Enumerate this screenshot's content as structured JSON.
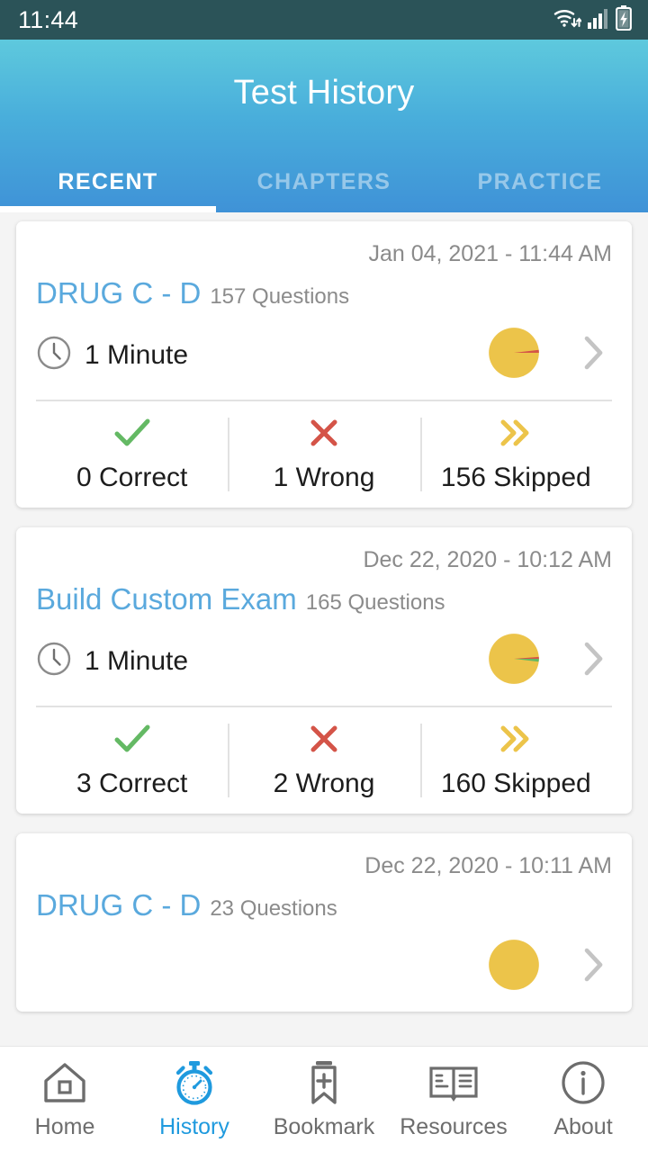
{
  "status_bar": {
    "time": "11:44",
    "icons": [
      "wifi-data-icon",
      "cellular-signal-icon",
      "battery-charging-icon"
    ]
  },
  "header": {
    "title": "Test History",
    "gradient_from": "#5ec9dd",
    "gradient_to": "#3f92d7",
    "tabs": [
      {
        "label": "RECENT",
        "active": true
      },
      {
        "label": "CHAPTERS",
        "active": false
      },
      {
        "label": "PRACTICE",
        "active": false
      }
    ]
  },
  "colors": {
    "accent_blue": "#5aa9dd",
    "active_nav": "#1f9ade",
    "correct_green": "#64b964",
    "wrong_red": "#d45448",
    "skipped_yellow": "#ecc44a",
    "muted_text": "#8b8b8b",
    "status_bar": "#2b5358"
  },
  "list": {
    "cards": [
      {
        "date": "Jan 04, 2021 - 11:44 AM",
        "title": "DRUG C - D",
        "questions": "157 Questions",
        "duration": "1 Minute",
        "chart_data": {
          "type": "pie",
          "title": "DRUG C - D result breakdown",
          "categories": [
            "Correct",
            "Wrong",
            "Skipped"
          ],
          "values": [
            0,
            1,
            156
          ],
          "colors": [
            "#64b964",
            "#d45448",
            "#ecc44a"
          ],
          "legend": "off"
        },
        "stats": [
          {
            "icon": "check-icon",
            "label": "0 Correct",
            "value": 0,
            "kind": "correct"
          },
          {
            "icon": "cross-icon",
            "label": "1 Wrong",
            "value": 1,
            "kind": "wrong"
          },
          {
            "icon": "double-chevron-right-icon",
            "label": "156 Skipped",
            "value": 156,
            "kind": "skipped"
          }
        ]
      },
      {
        "date": "Dec 22, 2020 - 10:12 AM",
        "title": "Build Custom Exam",
        "questions": "165 Questions",
        "duration": "1 Minute",
        "chart_data": {
          "type": "pie",
          "title": "Build Custom Exam result breakdown",
          "categories": [
            "Correct",
            "Wrong",
            "Skipped"
          ],
          "values": [
            3,
            2,
            160
          ],
          "colors": [
            "#64b964",
            "#d45448",
            "#ecc44a"
          ],
          "legend": "off"
        },
        "stats": [
          {
            "icon": "check-icon",
            "label": "3 Correct",
            "value": 3,
            "kind": "correct"
          },
          {
            "icon": "cross-icon",
            "label": "2 Wrong",
            "value": 2,
            "kind": "wrong"
          },
          {
            "icon": "double-chevron-right-icon",
            "label": "160 Skipped",
            "value": 160,
            "kind": "skipped"
          }
        ]
      },
      {
        "date": "Dec 22, 2020 - 10:11 AM",
        "title": "DRUG C - D",
        "questions": "23 Questions",
        "duration": "",
        "partial": true
      }
    ]
  },
  "bottom_nav": {
    "items": [
      {
        "icon": "home-icon",
        "label": "Home",
        "active": false
      },
      {
        "icon": "stopwatch-icon",
        "label": "History",
        "active": true
      },
      {
        "icon": "bookmark-add-icon",
        "label": "Bookmark",
        "active": false
      },
      {
        "icon": "open-book-icon",
        "label": "Resources",
        "active": false
      },
      {
        "icon": "info-circle-icon",
        "label": "About",
        "active": false
      }
    ]
  }
}
